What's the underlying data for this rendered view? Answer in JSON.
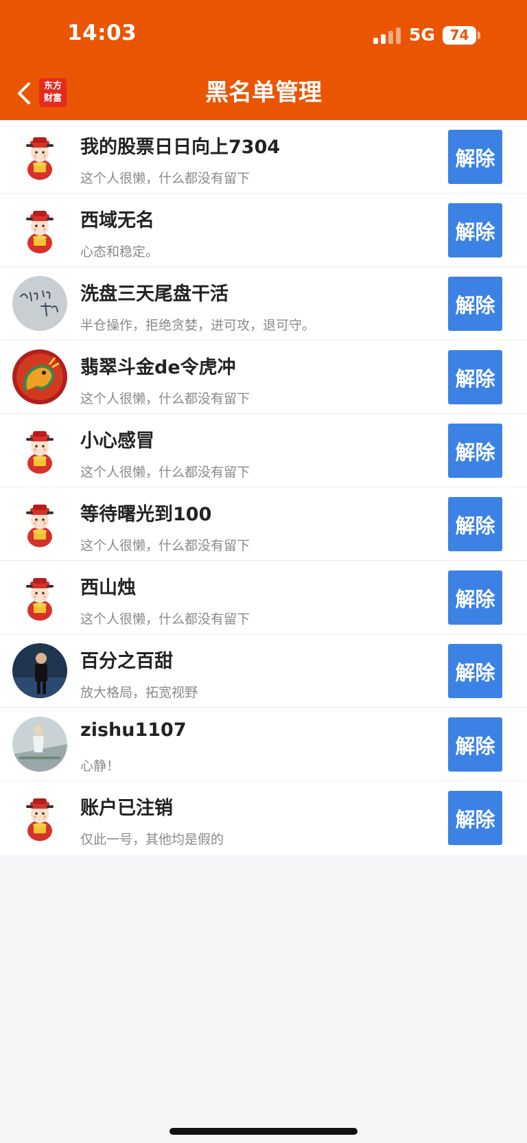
{
  "status_bar": {
    "time": "14:03",
    "network": "5G",
    "battery": "74"
  },
  "header": {
    "logo_line1": "东方",
    "logo_line2": "财富",
    "title": "黑名单管理"
  },
  "colors": {
    "header": "#ea5504",
    "button": "#3b82e4"
  },
  "users": [
    {
      "name": "我的股票日日向上7304",
      "bio": "这个人很懒，什么都没有留下",
      "avatar": "fortune-god-icon",
      "action": "解除"
    },
    {
      "name": "西域无名",
      "bio": "心态和稳定。",
      "avatar": "fortune-god-icon",
      "action": "解除"
    },
    {
      "name": "洗盘三天尾盘干活",
      "bio": "半仓操作，拒绝贪婪，进可攻，退可守。",
      "avatar": "calligraphy-avatar",
      "action": "解除"
    },
    {
      "name": "翡翠斗金de令虎冲",
      "bio": "这个人很懒，什么都没有留下",
      "avatar": "dragon-avatar",
      "action": "解除"
    },
    {
      "name": "小心感冒",
      "bio": "这个人很懒，什么都没有留下",
      "avatar": "fortune-god-icon",
      "action": "解除"
    },
    {
      "name": "等待曙光到100",
      "bio": "这个人很懒，什么都没有留下",
      "avatar": "fortune-god-icon",
      "action": "解除"
    },
    {
      "name": "西山烛",
      "bio": "这个人很懒，什么都没有留下",
      "avatar": "fortune-god-icon",
      "action": "解除"
    },
    {
      "name": "百分之百甜",
      "bio": "放大格局，拓宽视野",
      "avatar": "photo-avatar",
      "action": "解除"
    },
    {
      "name": "zishu1107",
      "bio": "心静！",
      "avatar": "photo-avatar",
      "action": "解除"
    },
    {
      "name": "账户已注销",
      "bio": "仅此一号，其他均是假的",
      "avatar": "fortune-god-icon",
      "action": "解除"
    }
  ]
}
